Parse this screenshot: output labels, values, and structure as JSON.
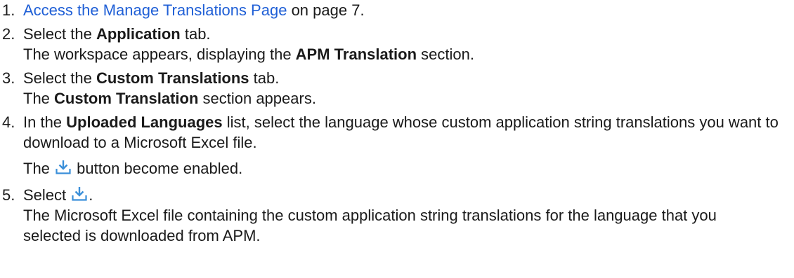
{
  "steps": [
    {
      "number": "1.",
      "link_text": "Access the Manage Translations Page",
      "after_link": " on page 7."
    },
    {
      "number": "2.",
      "pre": "Select the ",
      "bold": "Application",
      "post": " tab.",
      "result_pre": "The workspace appears, displaying the ",
      "result_bold": "APM Translation",
      "result_post": " section."
    },
    {
      "number": "3.",
      "pre": "Select the ",
      "bold": "Custom Translations",
      "post": " tab.",
      "result_pre": "The ",
      "result_bold": "Custom Translation",
      "result_post": " section appears."
    },
    {
      "number": "4.",
      "pre": "In the ",
      "bold": "Uploaded Languages",
      "post": " list, select the language whose custom application string translations you want to download to a Microsoft Excel file.",
      "result_pre": "The ",
      "result_post": " button become enabled."
    },
    {
      "number": "5.",
      "pre": "Select ",
      "post": ".",
      "result": "The Microsoft Excel file containing the custom application string translations for the language that you selected is downloaded from APM."
    }
  ],
  "icons": {
    "download": "download-icon",
    "color": "#3a8fd9"
  },
  "colors": {
    "link": "#1f5fd6",
    "text": "#1a1a1a"
  }
}
